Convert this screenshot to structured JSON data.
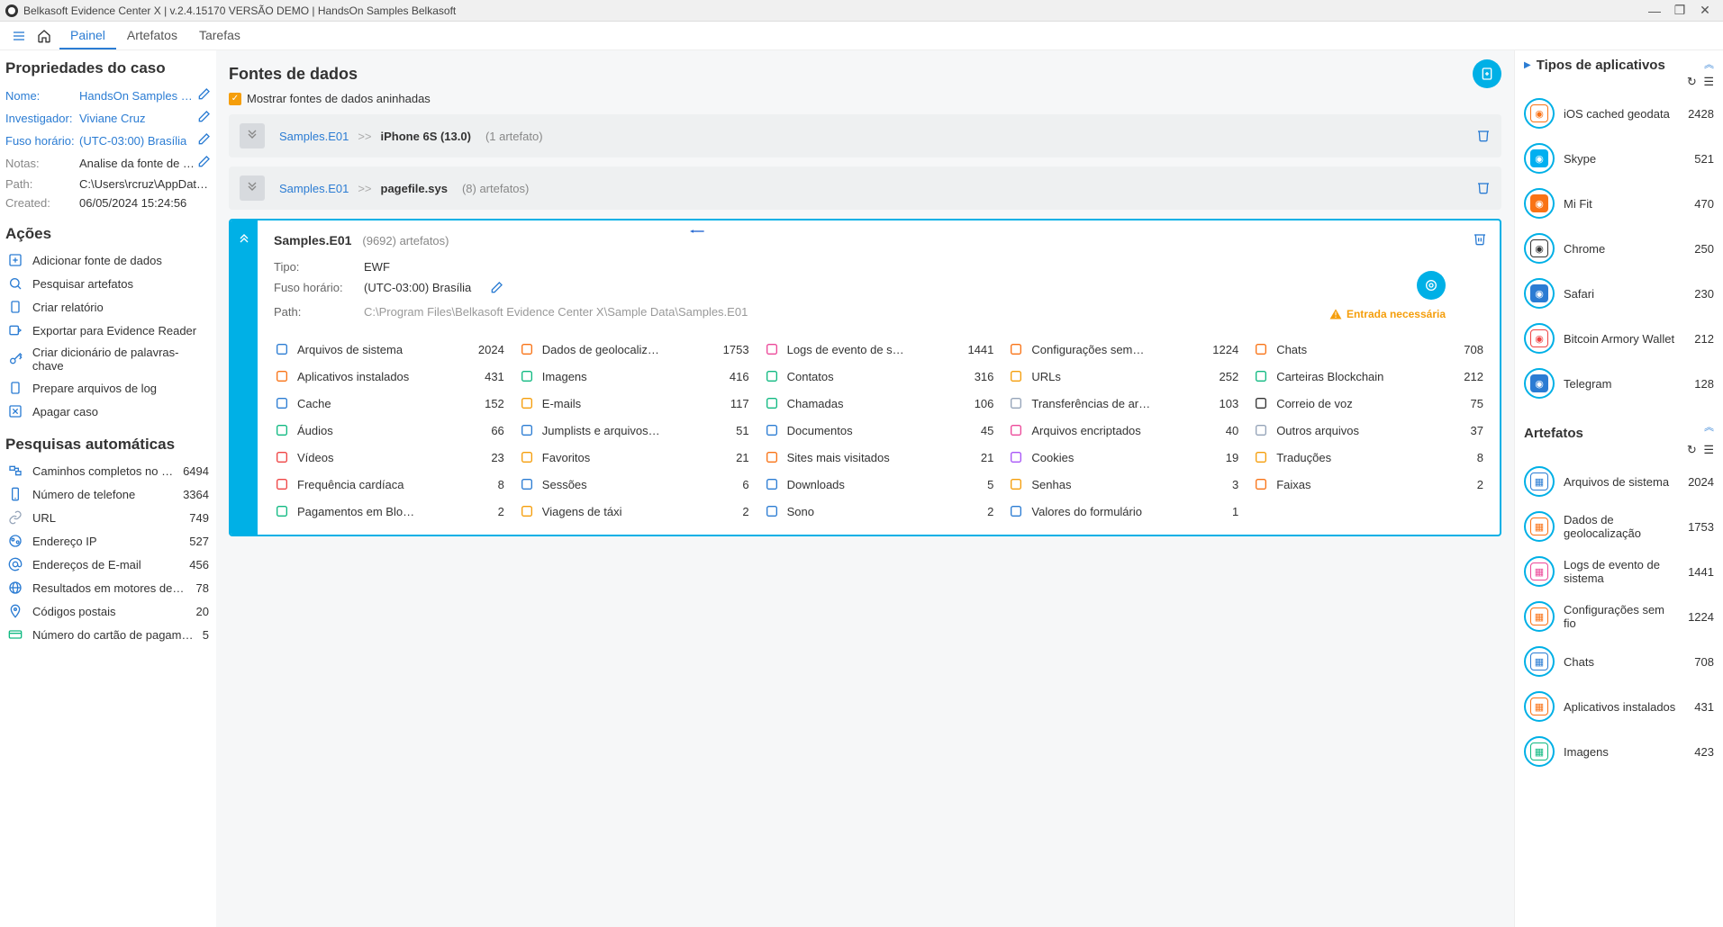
{
  "window": {
    "title": "Belkasoft Evidence Center X | v.2.4.15170 VERSÃO DEMO | HandsOn Samples Belkasoft"
  },
  "nav": {
    "tabs": [
      {
        "label": "Painel",
        "active": true
      },
      {
        "label": "Artefatos",
        "active": false
      },
      {
        "label": "Tarefas",
        "active": false
      }
    ]
  },
  "case": {
    "heading": "Propriedades do caso",
    "props": [
      {
        "label": "Nome:",
        "value": "HandsOn Samples Belka…",
        "link": true,
        "edit": true
      },
      {
        "label": "Investigador:",
        "value": "Viviane Cruz",
        "link": true,
        "edit": true
      },
      {
        "label": "Fuso horário:",
        "value": "(UTC-03:00) Brasília",
        "link": true,
        "edit": true
      },
      {
        "label": "Notas:",
        "value": "Analise da fonte de dados de image…",
        "muted": true,
        "edit": true
      },
      {
        "label": "Path:",
        "value": "C:\\Users\\rcruz\\AppData\\Roaming\\…",
        "muted": true
      },
      {
        "label": "Created:",
        "value": "06/05/2024 15:24:56",
        "muted": true
      }
    ]
  },
  "actions": {
    "heading": "Ações",
    "items": [
      {
        "label": "Adicionar fonte de dados",
        "icon": "plus"
      },
      {
        "label": "Pesquisar artefatos",
        "icon": "search"
      },
      {
        "label": "Criar relatório",
        "icon": "clipboard"
      },
      {
        "label": "Exportar para Evidence Reader",
        "icon": "export"
      },
      {
        "label": "Criar dicionário de palavras-chave",
        "icon": "key"
      },
      {
        "label": "Prepare arquivos de log",
        "icon": "clipboard"
      },
      {
        "label": "Apagar caso",
        "icon": "x"
      }
    ]
  },
  "autosearch": {
    "heading": "Pesquisas automáticas",
    "items": [
      {
        "label": "Caminhos completos no Wi…",
        "count": 6494,
        "icon": "path"
      },
      {
        "label": "Número de telefone",
        "count": 3364,
        "icon": "phone"
      },
      {
        "label": "URL",
        "count": 749,
        "icon": "link"
      },
      {
        "label": "Endereço IP",
        "count": 527,
        "icon": "ip"
      },
      {
        "label": "Endereços de E-mail",
        "count": 456,
        "icon": "at"
      },
      {
        "label": "Resultados em motores de pes…",
        "count": 78,
        "icon": "globe"
      },
      {
        "label": "Códigos postais",
        "count": 20,
        "icon": "pin"
      },
      {
        "label": "Número do cartão de pagamento",
        "count": 5,
        "icon": "card"
      }
    ]
  },
  "main": {
    "heading": "Fontes de dados",
    "checkbox_label": "Mostrar fontes de dados aninhadas",
    "sources": [
      {
        "part1": "Samples.E01",
        "part2": "iPhone 6S (13.0)",
        "count_label": "(1 artefato)"
      },
      {
        "part1": "Samples.E01",
        "part2": "pagefile.sys",
        "count_label": "(8) artefatos)"
      }
    ],
    "expanded": {
      "name": "Samples.E01",
      "count_label": "(9692) artefatos)",
      "meta": [
        {
          "label": "Tipo:",
          "value": "EWF"
        },
        {
          "label": "Fuso horário:",
          "value": "(UTC-03:00) Brasília",
          "edit": true
        },
        {
          "label": "Path:",
          "value": "C:\\Program Files\\Belkasoft Evidence Center X\\Sample Data\\Samples.E01",
          "muted": true
        }
      ],
      "warning": "Entrada necessária",
      "categories": [
        {
          "label": "Arquivos de sistema",
          "count": 2024,
          "color": "#2b7cd3"
        },
        {
          "label": "Dados de geolocaliz…",
          "count": 1753,
          "color": "#f97316"
        },
        {
          "label": "Logs de evento de s…",
          "count": 1441,
          "color": "#ec4899"
        },
        {
          "label": "Configurações sem…",
          "count": 1224,
          "color": "#f97316"
        },
        {
          "label": "Chats",
          "count": 708,
          "color": "#f97316"
        },
        {
          "label": "Aplicativos instalados",
          "count": 431,
          "color": "#f97316"
        },
        {
          "label": "Imagens",
          "count": 416,
          "color": "#10b981"
        },
        {
          "label": "Contatos",
          "count": 316,
          "color": "#10b981"
        },
        {
          "label": "URLs",
          "count": 252,
          "color": "#f59e0b"
        },
        {
          "label": "Carteiras Blockchain",
          "count": 212,
          "color": "#10b981"
        },
        {
          "label": "Cache",
          "count": 152,
          "color": "#2b7cd3"
        },
        {
          "label": "E-mails",
          "count": 117,
          "color": "#f59e0b"
        },
        {
          "label": "Chamadas",
          "count": 106,
          "color": "#10b981"
        },
        {
          "label": "Transferências de ar…",
          "count": 103,
          "color": "#94a3b8"
        },
        {
          "label": "Correio de voz",
          "count": 75,
          "color": "#333"
        },
        {
          "label": "Áudios",
          "count": 66,
          "color": "#10b981"
        },
        {
          "label": "Jumplists e arquivos…",
          "count": 51,
          "color": "#2b7cd3"
        },
        {
          "label": "Documentos",
          "count": 45,
          "color": "#2b7cd3"
        },
        {
          "label": "Arquivos encriptados",
          "count": 40,
          "color": "#ec4899"
        },
        {
          "label": "Outros arquivos",
          "count": 37,
          "color": "#94a3b8"
        },
        {
          "label": "Vídeos",
          "count": 23,
          "color": "#ef4444"
        },
        {
          "label": "Favoritos",
          "count": 21,
          "color": "#f59e0b"
        },
        {
          "label": "Sites mais visitados",
          "count": 21,
          "color": "#f97316"
        },
        {
          "label": "Cookies",
          "count": 19,
          "color": "#a855f7"
        },
        {
          "label": "Traduções",
          "count": 8,
          "color": "#f59e0b"
        },
        {
          "label": "Frequência cardíaca",
          "count": 8,
          "color": "#ef4444"
        },
        {
          "label": "Sessões",
          "count": 6,
          "color": "#2b7cd3"
        },
        {
          "label": "Downloads",
          "count": 5,
          "color": "#2b7cd3"
        },
        {
          "label": "Senhas",
          "count": 3,
          "color": "#f59e0b"
        },
        {
          "label": "Faixas",
          "count": 2,
          "color": "#f97316"
        },
        {
          "label": "Pagamentos em Blo…",
          "count": 2,
          "color": "#10b981"
        },
        {
          "label": "Viagens de táxi",
          "count": 2,
          "color": "#f59e0b"
        },
        {
          "label": "Sono",
          "count": 2,
          "color": "#2b7cd3"
        },
        {
          "label": "Valores do formulário",
          "count": 1,
          "color": "#2b7cd3"
        }
      ]
    }
  },
  "right": {
    "apps_heading": "Tipos de aplicativos",
    "apps": [
      {
        "label": "iOS cached geodata",
        "count": 2428,
        "bg": "#fff",
        "fg": "#f97316"
      },
      {
        "label": "Skype",
        "count": 521,
        "bg": "#00aff0",
        "fg": "#fff"
      },
      {
        "label": "Mi Fit",
        "count": 470,
        "bg": "#f97316",
        "fg": "#fff"
      },
      {
        "label": "Chrome",
        "count": 250,
        "bg": "#fff",
        "fg": "#333"
      },
      {
        "label": "Safari",
        "count": 230,
        "bg": "#2b7cd3",
        "fg": "#fff"
      },
      {
        "label": "Bitcoin Armory Wallet",
        "count": 212,
        "bg": "#fff",
        "fg": "#ef4444"
      },
      {
        "label": "Telegram",
        "count": 128,
        "bg": "#2b7cd3",
        "fg": "#fff"
      }
    ],
    "artifacts_heading": "Artefatos",
    "artifacts": [
      {
        "label": "Arquivos de sistema",
        "count": 2024,
        "fg": "#2b7cd3"
      },
      {
        "label": "Dados de geolocalização",
        "count": 1753,
        "fg": "#f97316"
      },
      {
        "label": "Logs de evento de sistema",
        "count": 1441,
        "fg": "#ec4899"
      },
      {
        "label": "Configurações sem fio",
        "count": 1224,
        "fg": "#f97316"
      },
      {
        "label": "Chats",
        "count": 708,
        "fg": "#2b7cd3"
      },
      {
        "label": "Aplicativos instalados",
        "count": 431,
        "fg": "#f97316"
      },
      {
        "label": "Imagens",
        "count": 423,
        "fg": "#10b981"
      }
    ]
  }
}
